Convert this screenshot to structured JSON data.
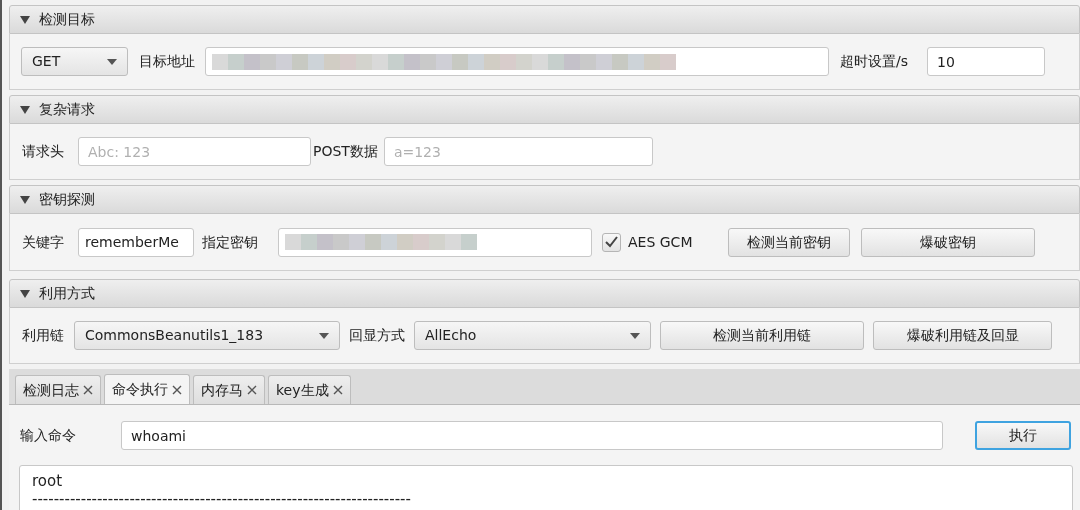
{
  "target": {
    "title": "检测目标",
    "expanded": true,
    "method": "GET",
    "url_label": "目标地址",
    "timeout_label": "超时设置/s",
    "timeout": "10"
  },
  "complex_request": {
    "title": "复杂请求",
    "expanded": true,
    "headers_label": "请求头",
    "headers_placeholder": "Abc: 123",
    "post_label": "POST数据",
    "post_placeholder": "a=123"
  },
  "key_detection": {
    "title": "密钥探测",
    "expanded": true,
    "keyword_label": "关键字",
    "keyword": "rememberMe",
    "key_label": "指定密钥",
    "aes_gcm": {
      "label": "AES GCM",
      "checked": true
    },
    "buttons": [
      "检测当前密钥",
      "爆破密钥"
    ]
  },
  "exploit": {
    "title": "利用方式",
    "expanded": true,
    "chain_label": "利用链",
    "chain": "CommonsBeanutils1_183",
    "echo_label": "回显方式",
    "echo": "AllEcho",
    "buttons": [
      "检测当前利用链",
      "爆破利用链及回显"
    ]
  },
  "tabs": [
    {
      "label": "检测日志",
      "selected": false
    },
    {
      "label": "命令执行",
      "selected": true
    },
    {
      "label": "内存马",
      "selected": false
    },
    {
      "label": "key生成",
      "selected": false
    }
  ],
  "command": {
    "label": "输入命令",
    "value": "whoami",
    "button": {
      "label": "执行",
      "focused": true
    }
  },
  "output": [
    "root",
    "----------------------------------------------------------------------"
  ]
}
